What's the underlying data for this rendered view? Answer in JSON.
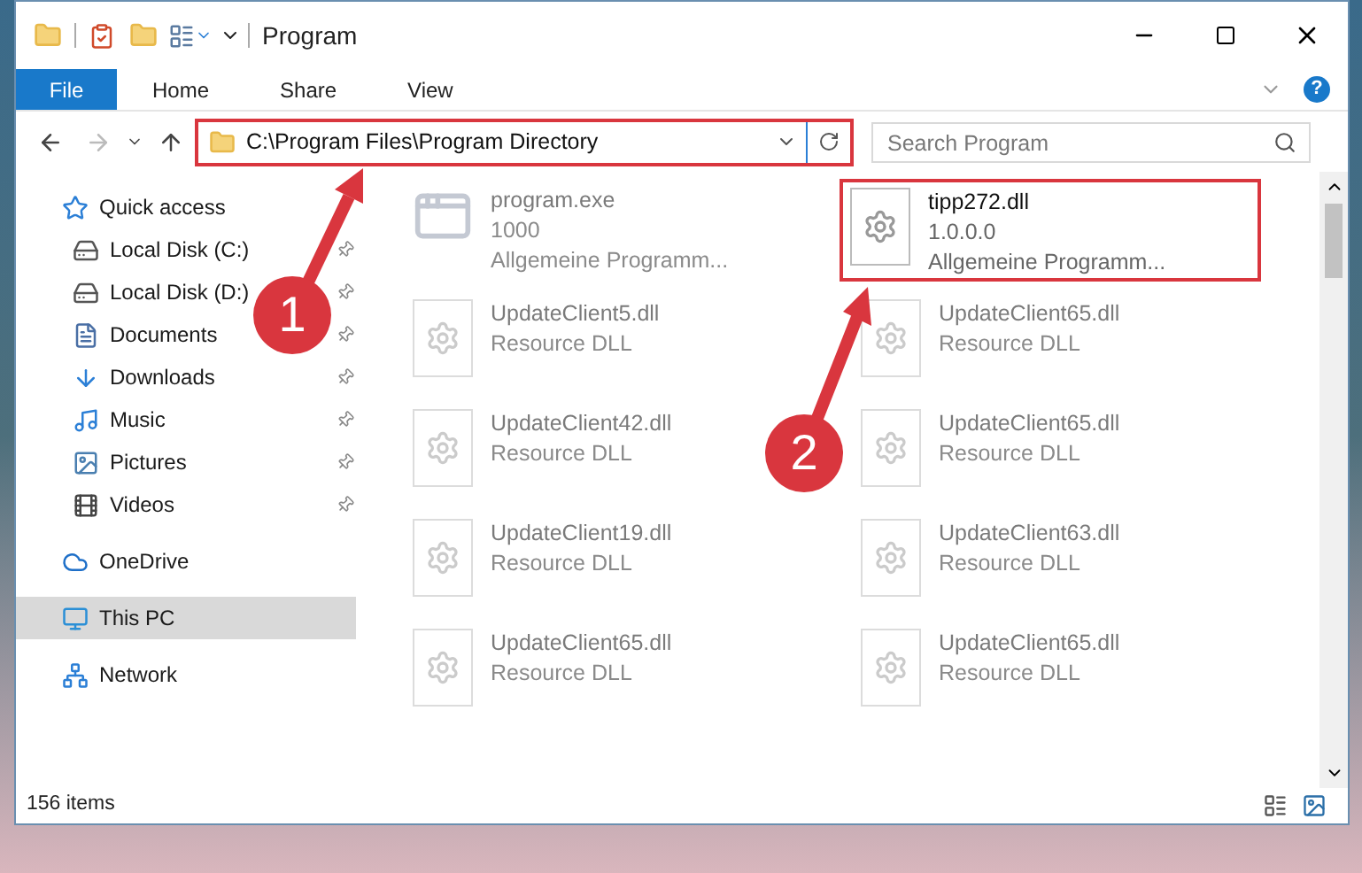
{
  "window": {
    "title": "Program"
  },
  "ribbon": {
    "tabs": [
      {
        "label": "File",
        "kind": "file",
        "selected": false
      },
      {
        "label": "Home",
        "kind": "tab",
        "selected": false
      },
      {
        "label": "Share",
        "kind": "tab",
        "selected": false
      },
      {
        "label": "View",
        "kind": "tab",
        "selected": false
      }
    ],
    "help": "?"
  },
  "address": {
    "path": "C:\\Program Files\\Program Directory",
    "highlighted": true
  },
  "search": {
    "placeholder": "Search Program"
  },
  "sidebar": {
    "items": [
      {
        "label": "Quick access",
        "kind": "star",
        "selected": false,
        "children": [
          {
            "label": "Local Disk (C:)",
            "kind": "disk",
            "pinned": true,
            "selected": false
          },
          {
            "label": "Local Disk (D:)",
            "kind": "disk",
            "pinned": true,
            "selected": false
          },
          {
            "label": "Documents",
            "kind": "doc",
            "pinned": true,
            "selected": false
          },
          {
            "label": "Downloads",
            "kind": "download",
            "pinned": true,
            "selected": false
          },
          {
            "label": "Music",
            "kind": "music",
            "pinned": true,
            "selected": false
          },
          {
            "label": "Pictures",
            "kind": "picture",
            "pinned": true,
            "selected": false
          },
          {
            "label": "Videos",
            "kind": "video",
            "pinned": true,
            "selected": false
          }
        ]
      },
      {
        "label": "OneDrive",
        "kind": "cloud",
        "selected": false
      },
      {
        "label": "This PC",
        "kind": "pc",
        "selected": true
      },
      {
        "label": "Network",
        "kind": "network",
        "selected": false
      }
    ]
  },
  "files": [
    {
      "name": "program.exe",
      "kind": "exe",
      "details": [
        "1000",
        "Allgemeine Programm..."
      ],
      "blurred": true,
      "highlighted": false
    },
    {
      "name": "tipp272.dll",
      "kind": "dll",
      "details": [
        "1.0.0.0",
        "Allgemeine Programm..."
      ],
      "blurred": false,
      "highlighted": true
    },
    {
      "name": "UpdateClient5.dll",
      "kind": "dll",
      "details": [
        "Resource DLL"
      ],
      "blurred": true,
      "highlighted": false
    },
    {
      "name": "UpdateClient65.dll",
      "kind": "dll",
      "details": [
        "Resource DLL"
      ],
      "blurred": true,
      "highlighted": false
    },
    {
      "name": "UpdateClient42.dll",
      "kind": "dll",
      "details": [
        "Resource DLL"
      ],
      "blurred": true,
      "highlighted": false
    },
    {
      "name": "UpdateClient65.dll",
      "kind": "dll",
      "details": [
        "Resource DLL"
      ],
      "blurred": true,
      "highlighted": false
    },
    {
      "name": "UpdateClient19.dll",
      "kind": "dll",
      "details": [
        "Resource DLL"
      ],
      "blurred": true,
      "highlighted": false
    },
    {
      "name": "UpdateClient63.dll",
      "kind": "dll",
      "details": [
        "Resource DLL"
      ],
      "blurred": true,
      "highlighted": false
    },
    {
      "name": "UpdateClient65.dll",
      "kind": "dll",
      "details": [
        "Resource DLL"
      ],
      "blurred": true,
      "highlighted": false
    },
    {
      "name": "UpdateClient65.dll",
      "kind": "dll",
      "details": [
        "Resource DLL"
      ],
      "blurred": true,
      "highlighted": false
    }
  ],
  "status_bar": {
    "count": "156 items"
  },
  "annotations": [
    {
      "number": "1"
    },
    {
      "number": "2"
    }
  ]
}
